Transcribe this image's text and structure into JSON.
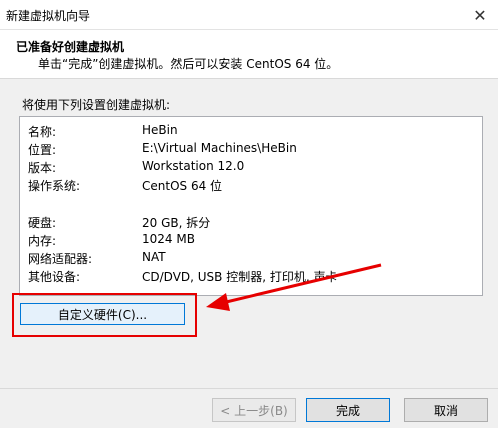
{
  "window": {
    "title": "新建虚拟机向导",
    "close_glyph": "✕"
  },
  "header": {
    "title": "已准备好创建虚拟机",
    "subtitle": "单击“完成”创建虚拟机。然后可以安装 CentOS 64 位。"
  },
  "intro": "将使用下列设置创建虚拟机:",
  "settings": [
    {
      "label": "名称:",
      "value": "HeBin"
    },
    {
      "label": "位置:",
      "value": "E:\\Virtual Machines\\HeBin"
    },
    {
      "label": "版本:",
      "value": "Workstation 12.0"
    },
    {
      "label": "操作系统:",
      "value": "CentOS 64 位"
    },
    {
      "label": "硬盘:",
      "value": "20 GB, 拆分"
    },
    {
      "label": "内存:",
      "value": "1024 MB"
    },
    {
      "label": "网络适配器:",
      "value": "NAT"
    },
    {
      "label": "其他设备:",
      "value": "CD/DVD, USB 控制器, 打印机, 声卡"
    }
  ],
  "buttons": {
    "customize": "自定义硬件(C)...",
    "back": "< 上一步(B)",
    "finish": "完成",
    "cancel": "取消"
  },
  "colors": {
    "highlight": "#e60000",
    "accent": "#0078d7"
  }
}
